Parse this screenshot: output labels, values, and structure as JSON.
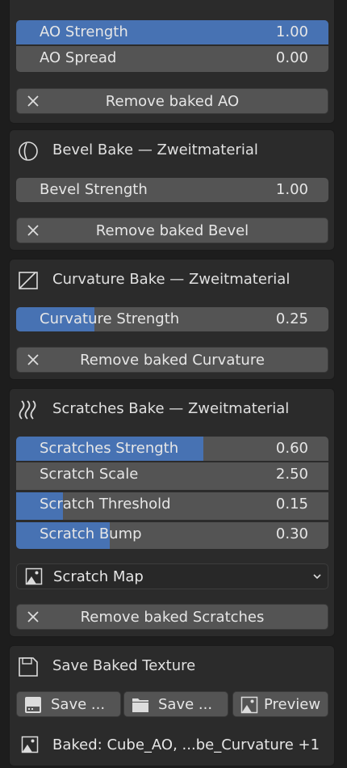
{
  "ao": {
    "sliders": [
      {
        "label": "AO Strength",
        "value": "1.00",
        "fill": 1.0
      },
      {
        "label": "AO Spread",
        "value": "0.00",
        "fill": 0.0
      }
    ],
    "remove_label": "Remove baked AO"
  },
  "bevel": {
    "title": "Bevel Bake — Zweitmaterial",
    "icon": "bevel-circle-icon",
    "sliders": [
      {
        "label": "Bevel Strength",
        "value": "1.00",
        "fill": 0.0
      }
    ],
    "remove_label": "Remove baked Bevel"
  },
  "curvature": {
    "title": "Curvature Bake — Zweitmaterial",
    "icon": "curvature-corner-icon",
    "sliders": [
      {
        "label": "Curvature Strength",
        "value": "0.25",
        "fill": 0.25
      }
    ],
    "remove_label": "Remove baked Curvature"
  },
  "scratches": {
    "title": "Scratches Bake — Zweitmaterial",
    "icon": "scratches-wave-icon",
    "sliders": [
      {
        "label": "Scratches Strength",
        "value": "0.60",
        "fill": 0.6
      },
      {
        "label": "Scratch Scale",
        "value": "2.50",
        "fill": 0.0
      },
      {
        "label": "Scratch Threshold",
        "value": "0.15",
        "fill": 0.15
      },
      {
        "label": "Scratch Bump",
        "value": "0.30",
        "fill": 0.3
      }
    ],
    "map_label": "Scratch Map",
    "remove_label": "Remove baked Scratches"
  },
  "save": {
    "title": "Save Baked Texture",
    "icon": "floppy-disk-icon",
    "buttons": [
      {
        "label": "Save ...",
        "icon": "disk-icon"
      },
      {
        "label": "Save ...",
        "icon": "folder-icon"
      },
      {
        "label": "Preview",
        "icon": "image-icon"
      }
    ],
    "baked_info": "Baked: Cube_AO, ...be_Curvature +1"
  },
  "colors": {
    "accent": "#4772b3",
    "field": "#545454",
    "panel": "#2b2b2b",
    "bg": "#1d1d1d"
  }
}
